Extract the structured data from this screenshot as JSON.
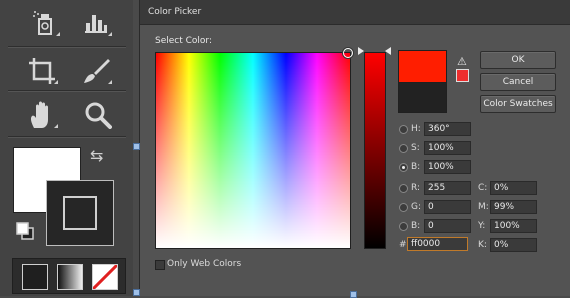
{
  "dialog": {
    "title": "Color Picker",
    "select_label": "Select Color:",
    "buttons": {
      "ok": "OK",
      "cancel": "Cancel",
      "swatches": "Color Swatches"
    },
    "new_color": "#ff1e00",
    "current_color": "#222222",
    "fields": {
      "h": {
        "label": "H:",
        "value": "360°"
      },
      "s": {
        "label": "S:",
        "value": "100%"
      },
      "b_hsb": {
        "label": "B:",
        "value": "100%"
      },
      "r": {
        "label": "R:",
        "value": "255"
      },
      "g": {
        "label": "G:",
        "value": "0"
      },
      "b_rgb": {
        "label": "B:",
        "value": "0"
      },
      "c": {
        "label": "C:",
        "value": "0%"
      },
      "m": {
        "label": "M:",
        "value": "99%"
      },
      "y": {
        "label": "Y:",
        "value": "100%"
      },
      "k": {
        "label": "K:",
        "value": "0%"
      },
      "hex": {
        "label": "#",
        "value": "ff0000"
      }
    },
    "only_web_colors": "Only Web Colors",
    "selected_radio": "b_hsb"
  },
  "tools": {
    "items": [
      "spray-bottle-icon",
      "histogram-icon",
      "crop-icon",
      "brush-icon",
      "hand-icon",
      "zoom-icon"
    ],
    "foreground": "#ffffff",
    "background": "#262626"
  }
}
